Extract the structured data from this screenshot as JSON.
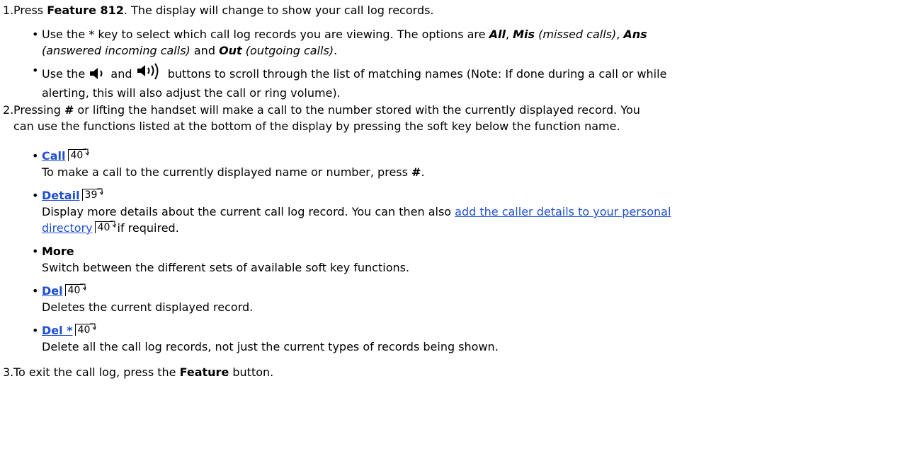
{
  "steps": [
    {
      "num": "1.",
      "text_pre": "Press ",
      "text_bold": "Feature 812",
      "text_post": ". The display will change to show your call log records.",
      "bullets": [
        {
          "line1_pre": "Use the * key to select which call log records you are viewing. The options are ",
          "opt_all": "All",
          "sep1": ", ",
          "opt_mis": "Mis",
          "mis_desc": " (missed calls)",
          "sep2": ", ",
          "opt_ans": "Ans",
          "line2_ans_desc": "(answered incoming calls)",
          "and": " and ",
          "opt_out": "Out",
          "out_desc": " (outgoing calls)",
          "end": "."
        },
        {
          "use_the": "Use the ",
          "and": " and ",
          "rest": " buttons to scroll through the list of matching names (Note: If done during a call or while",
          "line2": "alerting, this will also adjust the call or ring volume).",
          "icon_down": "volume-down-icon",
          "icon_up": "volume-up-icon"
        }
      ]
    },
    {
      "num": "2.",
      "line1": "Pressing # or lifting the handset will make a call to the number stored with the currently displayed record. You",
      "line1_pre": "Pressing ",
      "line1_hash": "#",
      "line1_post": " or lifting the handset will make a call to the number stored with the currently displayed record. You",
      "line2": "can use the functions listed at the bottom of the display by pressing the soft key below the function name.",
      "functions": [
        {
          "label": "Call",
          "page": "40",
          "desc_pre": "To make a call to the currently displayed name or number, press ",
          "desc_bold": "#",
          "desc_post": "."
        },
        {
          "label": "Detail",
          "page": "39",
          "desc_pre": "Display more details about the current call log record. You can then also ",
          "desc_link": "add the caller details to your personal",
          "desc_link2": "directory",
          "link_page": "40",
          "desc_post": " if required."
        },
        {
          "label": "More",
          "desc": "Switch between the different sets of available soft key functions."
        },
        {
          "label": "Del",
          "page": "40",
          "desc": "Deletes the current displayed record."
        },
        {
          "label": "Del *",
          "page": "40",
          "desc": "Delete all the call log records, not just the current types of records being shown."
        }
      ]
    },
    {
      "num": "3.",
      "text_pre": "To exit the call log, press the ",
      "text_bold": "Feature",
      "text_post": " button."
    }
  ]
}
